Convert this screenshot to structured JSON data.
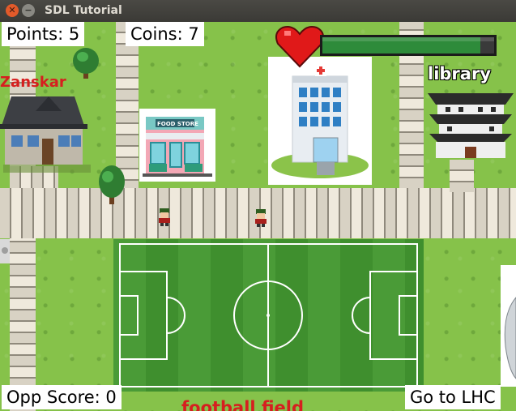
{
  "window": {
    "title": "SDL Tutorial"
  },
  "hud": {
    "points_label": "Points: 5",
    "coins_label": "Coins: 7",
    "opp_score_label": "Opp Score: 0",
    "goto_label": "Go to LHC",
    "health_fraction": 0.92
  },
  "map_labels": {
    "zanskar": "Zanskar",
    "library": "library",
    "football": "football field",
    "food_store_sign": "FOOD STORE"
  },
  "colors": {
    "grass": "#86c24a",
    "field": "#3f8f2e",
    "heart": "#e01919",
    "health_bar": "#2e8b3a",
    "zanskar_text": "#d61f1f",
    "football_text": "#d61f1f"
  }
}
